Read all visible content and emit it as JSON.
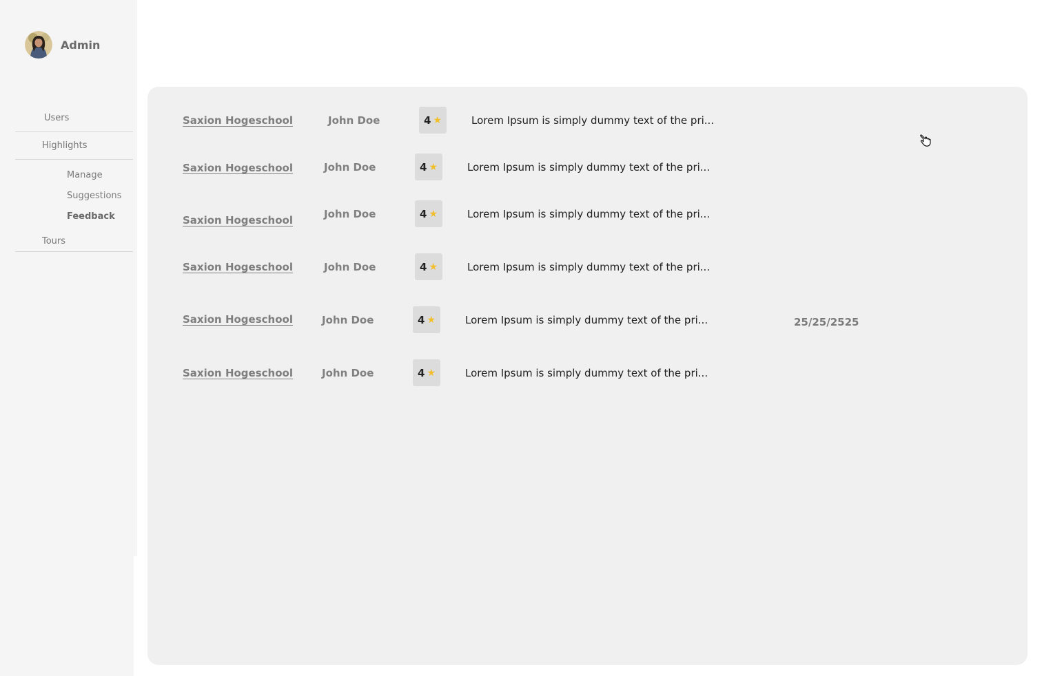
{
  "sidebar": {
    "admin_name": "Admin",
    "nav": {
      "users": "Users",
      "highlights": "Highlights",
      "manage": "Manage",
      "suggestions": "Suggestions",
      "feedback": "Feedback",
      "tours": "Tours"
    }
  },
  "feedback": {
    "rows": [
      {
        "school": "Saxion Hogeschool",
        "name": "John Doe",
        "rating": "4",
        "text": "Lorem Ipsum is simply dummy text of the pri..."
      },
      {
        "school": "Saxion Hogeschool",
        "name": "John Doe",
        "rating": "4",
        "text": "Lorem Ipsum is simply dummy text of the pri..."
      },
      {
        "school": "Saxion Hogeschool",
        "name": "John Doe",
        "rating": "4",
        "text": "Lorem Ipsum is simply dummy text of the pri..."
      },
      {
        "school": "Saxion Hogeschool",
        "name": "John Doe",
        "rating": "4",
        "text": "Lorem Ipsum is simply dummy text of the pri..."
      },
      {
        "school": "Saxion Hogeschool",
        "name": "John Doe",
        "rating": "4",
        "text": "Lorem Ipsum is simply dummy text of the pri...",
        "date": "25/25/2525"
      },
      {
        "school": "Saxion Hogeschool",
        "name": "John Doe",
        "rating": "4",
        "text": "Lorem Ipsum is simply dummy text of the pri..."
      }
    ]
  },
  "colors": {
    "sidebar_bg": "#f5f5f5",
    "panel_bg": "#f0f0f0",
    "rating_bg": "#dcdcdc",
    "star": "#f2bf2b"
  },
  "icons": {
    "rating": "star-icon",
    "cursor": "hand-pointer-icon"
  }
}
